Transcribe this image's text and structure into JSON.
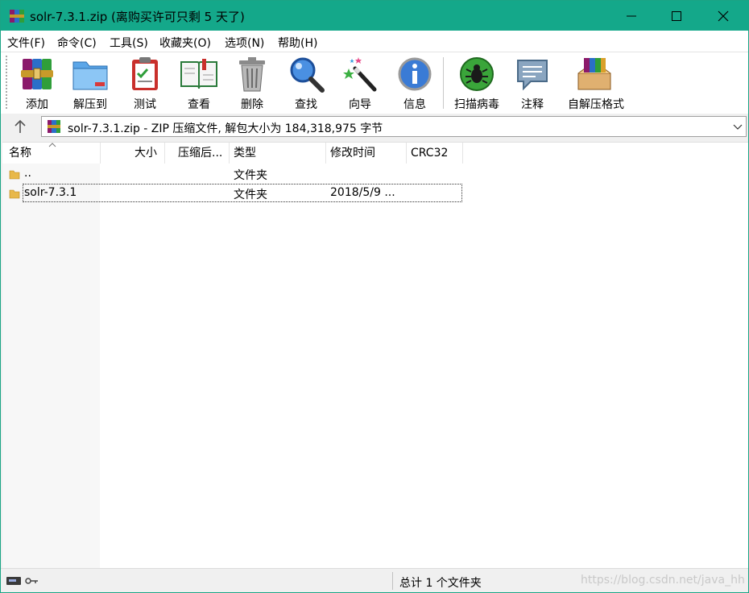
{
  "window": {
    "title": "solr-7.3.1.zip (离购买许可只剩 5 天了)",
    "accent_color": "#14a88a"
  },
  "menu": {
    "items": [
      "文件(F)",
      "命令(C)",
      "工具(S)",
      "收藏夹(O)",
      "选项(N)",
      "帮助(H)"
    ]
  },
  "toolbar": {
    "items": [
      {
        "label": "添加",
        "icon": "add-archive-icon"
      },
      {
        "label": "解压到",
        "icon": "extract-to-icon"
      },
      {
        "label": "测试",
        "icon": "test-clipboard-icon"
      },
      {
        "label": "查看",
        "icon": "view-book-icon"
      },
      {
        "label": "删除",
        "icon": "delete-trash-icon"
      },
      {
        "label": "查找",
        "icon": "find-magnifier-icon"
      },
      {
        "label": "向导",
        "icon": "wizard-wand-icon"
      },
      {
        "label": "信息",
        "icon": "info-icon"
      },
      {
        "label": "扫描病毒",
        "icon": "scan-virus-icon"
      },
      {
        "label": "注释",
        "icon": "comment-icon"
      },
      {
        "label": "自解压格式",
        "icon": "sfx-archive-icon"
      }
    ]
  },
  "address": {
    "path": "solr-7.3.1.zip - ZIP 压缩文件, 解包大小为 184,318,975 字节"
  },
  "columns": {
    "name": "名称",
    "size": "大小",
    "packed": "压缩后...",
    "type": "类型",
    "modified": "修改时间",
    "crc": "CRC32"
  },
  "rows": [
    {
      "name": "..",
      "type": "文件夹",
      "modified": ""
    },
    {
      "name": "solr-7.3.1",
      "type": "文件夹",
      "modified": "2018/5/9 ..."
    }
  ],
  "status": {
    "summary": "总计 1 个文件夹",
    "watermark": "https://blog.csdn.net/java_hh"
  }
}
